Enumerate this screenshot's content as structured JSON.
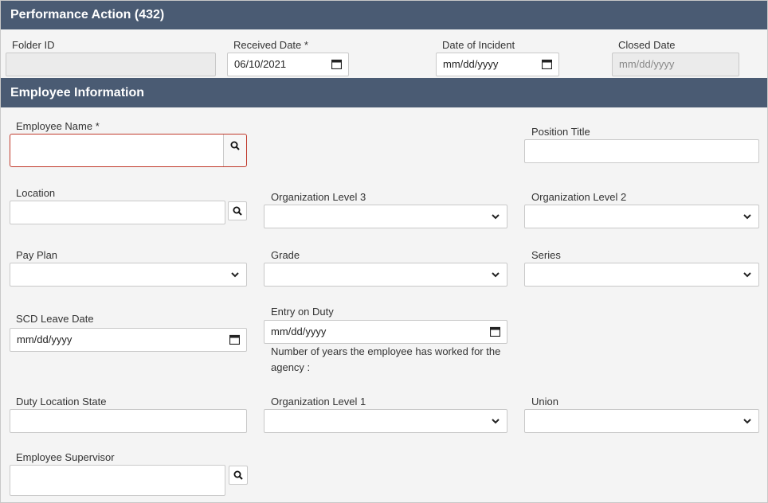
{
  "header": {
    "title": "Performance Action (432)"
  },
  "case": {
    "folder_id": {
      "label": "Folder ID",
      "value": ""
    },
    "received_date": {
      "label": "Received Date *",
      "value": "06/10/2021"
    },
    "date_of_incident": {
      "label": "Date of Incident",
      "value": "mm/dd/yyyy"
    },
    "closed_date": {
      "label": "Closed Date",
      "value": "mm/dd/yyyy"
    }
  },
  "employee_section": {
    "title": "Employee Information",
    "employee_name": {
      "label": "Employee Name *",
      "value": ""
    },
    "position_title": {
      "label": "Position Title",
      "value": ""
    },
    "location": {
      "label": "Location",
      "value": ""
    },
    "org_level_3": {
      "label": "Organization Level 3",
      "value": ""
    },
    "org_level_2": {
      "label": "Organization Level 2",
      "value": ""
    },
    "pay_plan": {
      "label": "Pay Plan",
      "value": ""
    },
    "grade": {
      "label": "Grade",
      "value": ""
    },
    "series": {
      "label": "Series",
      "value": ""
    },
    "scd_leave_date": {
      "label": "SCD Leave Date",
      "value": "mm/dd/yyyy"
    },
    "entry_on_duty": {
      "label": "Entry on Duty",
      "value": "mm/dd/yyyy"
    },
    "years_note": "Number of years the employee has worked for the agency :",
    "duty_location_state": {
      "label": "Duty Location State",
      "value": ""
    },
    "org_level_1": {
      "label": "Organization Level 1",
      "value": ""
    },
    "union": {
      "label": "Union",
      "value": ""
    },
    "employee_supervisor": {
      "label": "Employee Supervisor",
      "value": ""
    }
  },
  "icons": {
    "search": "search-icon",
    "calendar": "calendar-icon",
    "dropdown": "chevron-down-icon"
  },
  "colors": {
    "header_bg": "#4a5b73",
    "header_text": "#ffffff",
    "error_border": "#c0392b",
    "page_bg": "#f4f4f4"
  }
}
